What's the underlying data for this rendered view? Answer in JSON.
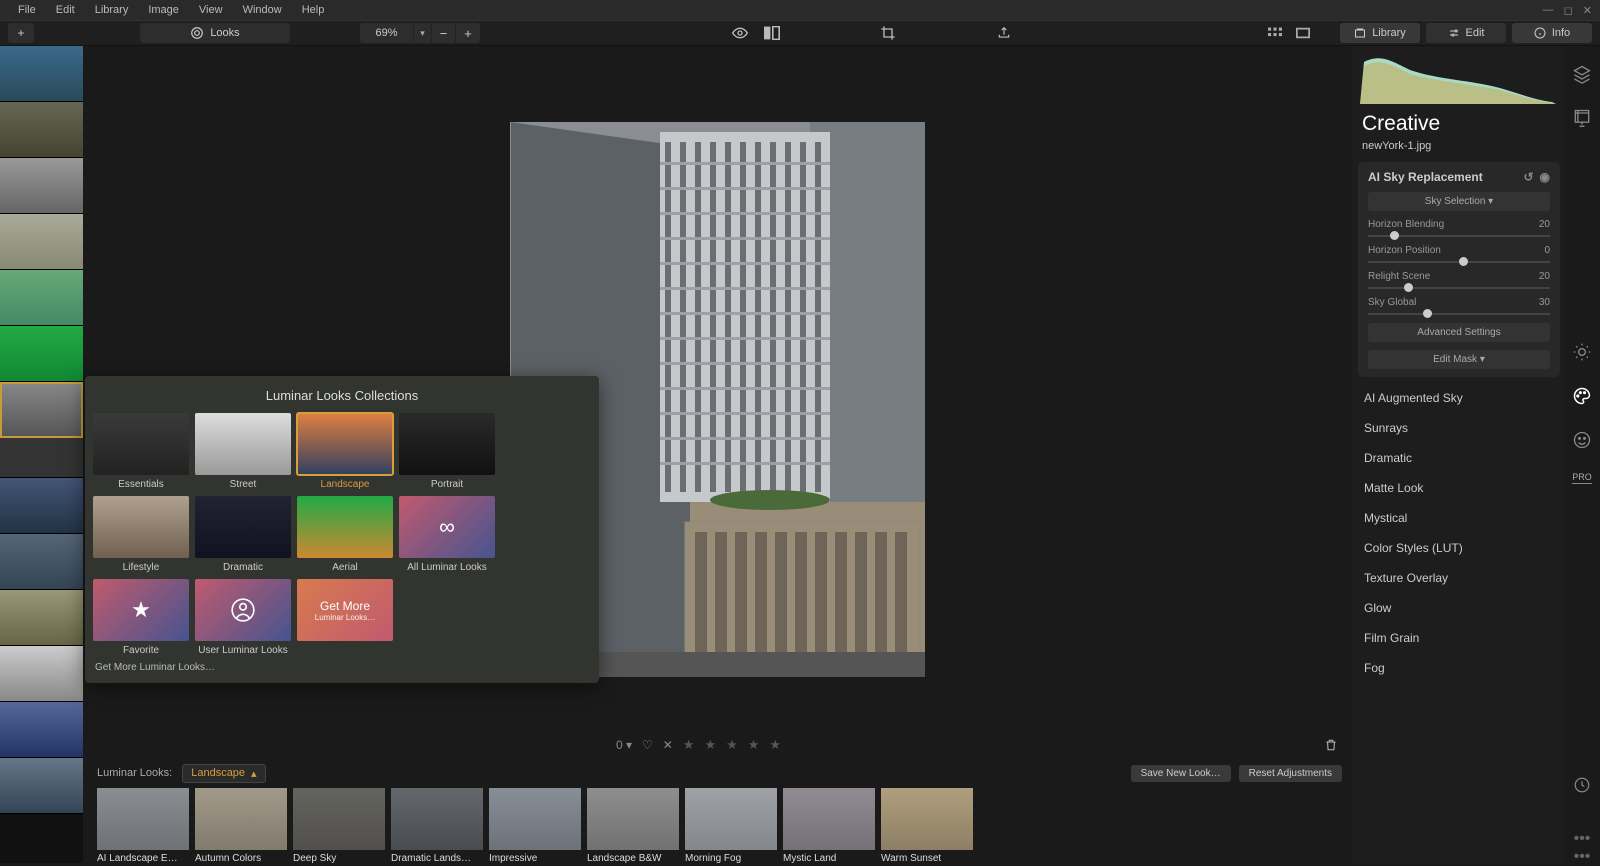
{
  "menubar": [
    "File",
    "Edit",
    "Library",
    "Image",
    "View",
    "Window",
    "Help"
  ],
  "toolbar": {
    "looks_label": "Looks",
    "zoom": "69%"
  },
  "tabs": {
    "library": "Library",
    "edit": "Edit",
    "info": "Info"
  },
  "panel": {
    "title": "Creative",
    "filename": "newYork-1.jpg"
  },
  "sky_tool": {
    "title": "AI Sky Replacement",
    "select_btn": "Sky Selection ▾",
    "sliders": [
      {
        "label": "Horizon Blending",
        "value": "20",
        "pos": 12
      },
      {
        "label": "Horizon Position",
        "value": "0",
        "pos": 50
      },
      {
        "label": "Relight Scene",
        "value": "20",
        "pos": 20
      },
      {
        "label": "Sky Global",
        "value": "30",
        "pos": 30
      }
    ],
    "adv_btn": "Advanced Settings",
    "mask_btn": "Edit Mask ▾"
  },
  "filters": [
    "AI Augmented Sky",
    "Sunrays",
    "Dramatic",
    "Matte Look",
    "Mystical",
    "Color Styles (LUT)",
    "Texture Overlay",
    "Glow",
    "Film Grain",
    "Fog"
  ],
  "bottom_info": {
    "zero": "0 ▾"
  },
  "looks_bar": {
    "label": "Luminar Looks:",
    "selected": "Landscape",
    "save_btn": "Save New Look…",
    "reset_btn": "Reset Adjustments",
    "items": [
      "AI Landscape E…",
      "Autumn Colors",
      "Deep Sky",
      "Dramatic Lands…",
      "Impressive",
      "Landscape B&W",
      "Morning Fog",
      "Mystic Land",
      "Warm Sunset"
    ]
  },
  "popup": {
    "title": "Luminar Looks Collections",
    "items": [
      {
        "label": "Essentials",
        "type": "img",
        "grad": "ess"
      },
      {
        "label": "Street",
        "type": "img",
        "grad": "str"
      },
      {
        "label": "Landscape",
        "type": "img",
        "grad": "land",
        "selected": true
      },
      {
        "label": "Portrait",
        "type": "img",
        "grad": "port"
      },
      {
        "label": "Lifestyle",
        "type": "img",
        "grad": "life"
      },
      {
        "label": "Dramatic",
        "type": "img",
        "grad": "dram"
      },
      {
        "label": "Aerial",
        "type": "img",
        "grad": "aer"
      },
      {
        "label": "All Luminar Looks",
        "type": "grad",
        "icon": "infinity"
      },
      {
        "label": "Favorite",
        "type": "grad",
        "icon": "star"
      },
      {
        "label": "User Luminar Looks",
        "type": "grad",
        "icon": "user"
      }
    ],
    "getmore": {
      "title": "Get More",
      "sub": "Luminar Looks…"
    },
    "footer": "Get More Luminar Looks…"
  },
  "side_badge": "PRO"
}
